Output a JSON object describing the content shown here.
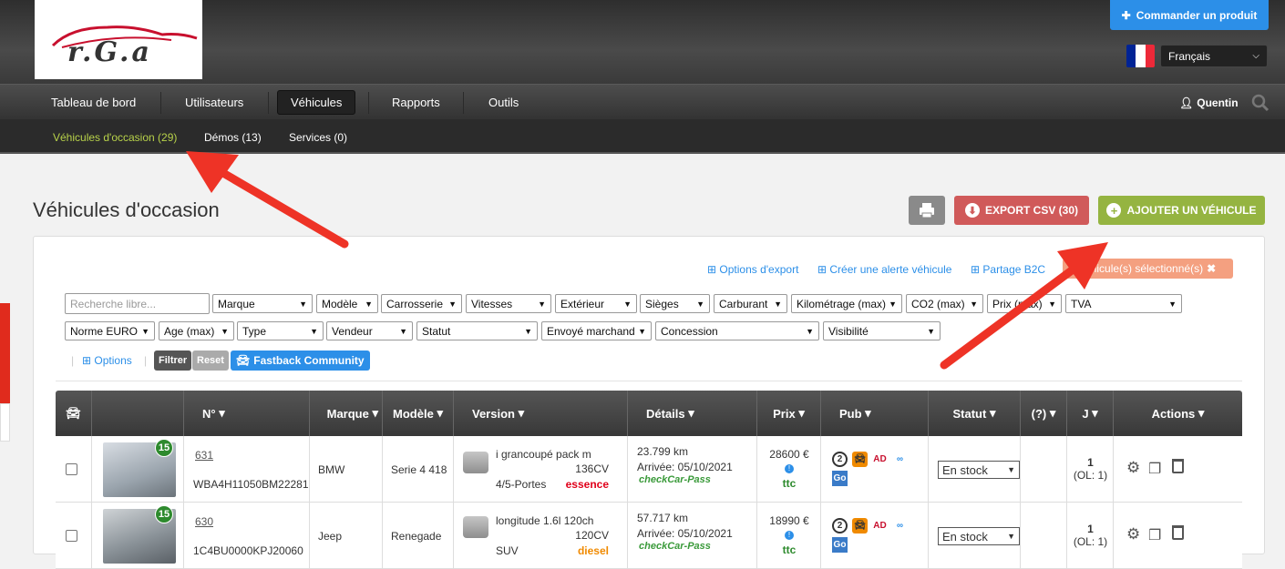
{
  "header": {
    "logo_text": "r.G.a",
    "order_button": "Commander un produit",
    "language": "Français",
    "flag_colors": [
      "#002395",
      "#ffffff",
      "#ed2939"
    ]
  },
  "nav": {
    "items": [
      "Tableau de bord",
      "Utilisateurs",
      "Véhicules",
      "Rapports",
      "Outils"
    ],
    "active": "Véhicules",
    "user": "Quentin"
  },
  "subnav": {
    "items": [
      "Véhicules d'occasion (29)",
      "Démos (13)",
      "Services (0)"
    ],
    "active_color": "#b8d24a"
  },
  "page": {
    "title": "Véhicules d'occasion",
    "export_csv": "EXPORT CSV (30)",
    "add_vehicle": "AJOUTER UN VÉHICULE"
  },
  "toolbar_links": {
    "export_options": "Options d'export",
    "create_alert": "Créer une alerte véhicule",
    "share_b2c": "Partage B2C",
    "selected": "0 véhicule(s) sélectionné(s)"
  },
  "filters": {
    "search_placeholder": "Recherche libre...",
    "row1": [
      "Marque",
      "Modèle",
      "Carrosserie",
      "Vitesses",
      "Extérieur",
      "Sièges",
      "Carburant",
      "Kilométrage (max)",
      "CO2 (max)",
      "Prix (max)",
      "TVA"
    ],
    "row2": [
      "Norme EURO",
      "Age (max)",
      "Type",
      "Vendeur",
      "Statut",
      "Envoyé marchand",
      "Concession",
      "Visibilité"
    ],
    "options": "Options",
    "filter_btn": "Filtrer",
    "reset_btn": "Reset",
    "community_btn": "Fastback Community"
  },
  "table": {
    "headers": [
      "N°",
      "Marque",
      "Modèle",
      "Version",
      "Détails",
      "Prix",
      "Pub",
      "Statut",
      "(?)",
      "J",
      "Actions"
    ],
    "rows": [
      {
        "badge": "15",
        "id": "631",
        "vin": "WBA4H11050BM22281",
        "brand": "BMW",
        "model": "Serie 4 418",
        "version": "i grancoupé pack m",
        "power": "136CV",
        "body": "4/5-Portes",
        "fuel": "essence",
        "fuel_color": "#e0001a",
        "km": "23.799 km",
        "arrival": "Arrivée: 05/10/2021",
        "carpass": "checkCar-Pass",
        "price": "28600 €",
        "ttc": "ttc",
        "status": "En stock",
        "days": "1",
        "ol": "(OL: 1)"
      },
      {
        "badge": "15",
        "id": "630",
        "vin": "1C4BU0000KPJ20060",
        "brand": "Jeep",
        "model": "Renegade",
        "version": "longitude 1.6l 120ch",
        "power": "120CV",
        "body": "SUV",
        "fuel": "diesel",
        "fuel_color": "#f08a00",
        "km": "57.717 km",
        "arrival": "Arrivée: 05/10/2021",
        "carpass": "checkCar-Pass",
        "price": "18990 €",
        "ttc": "ttc",
        "status": "En stock",
        "days": "1",
        "ol": "(OL: 1)"
      }
    ]
  }
}
